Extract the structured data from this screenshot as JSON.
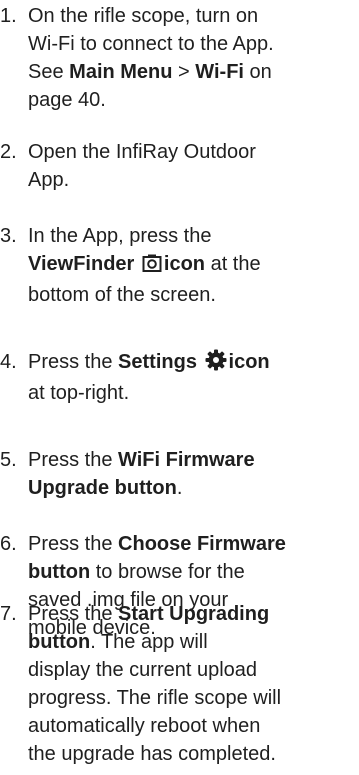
{
  "steps": [
    {
      "num": "1.",
      "l1": "On the rifle scope, turn on",
      "l2": "Wi-Fi to connect to the App.",
      "l3a": "See ",
      "l3b": "Main Menu",
      "l3c": " > ",
      "l3d": "Wi-Fi",
      "l3e": " on",
      "l4": "page 40."
    },
    {
      "num": "2.",
      "l1": "Open the InfiRay Outdoor",
      "l2": "App."
    },
    {
      "num": "3.",
      "l1": "In the App, press the",
      "l2a": "ViewFinder",
      "l2b": "icon",
      "l2c": " at the",
      "l3": "bottom of the screen.",
      "icon": "viewfinder-camera-icon"
    },
    {
      "num": "4.",
      "l1a": "Press the ",
      "l1b": "Settings",
      "l1c": "icon",
      "l2": "at top-right.",
      "icon": "gear-icon"
    },
    {
      "num": "5.",
      "l1a": "Press the ",
      "l1b": "WiFi Firmware",
      "l2a": "Upgrade button",
      "l2b": "."
    },
    {
      "num": "6.",
      "l1a": "Press the ",
      "l1b": "Choose Firmware",
      "l2a": "button",
      "l2b": " to browse for the",
      "l3": "saved .img file on your",
      "l4": "mobile device."
    },
    {
      "num": "7.",
      "l1a": "Press the ",
      "l1b": "Start Upgrading",
      "l2a": "button",
      "l2b": ". The app will",
      "l3": "display the current upload",
      "l4": "progress. The rifle scope will",
      "l5": "automatically reboot when",
      "l6": "the upgrade has completed."
    }
  ]
}
